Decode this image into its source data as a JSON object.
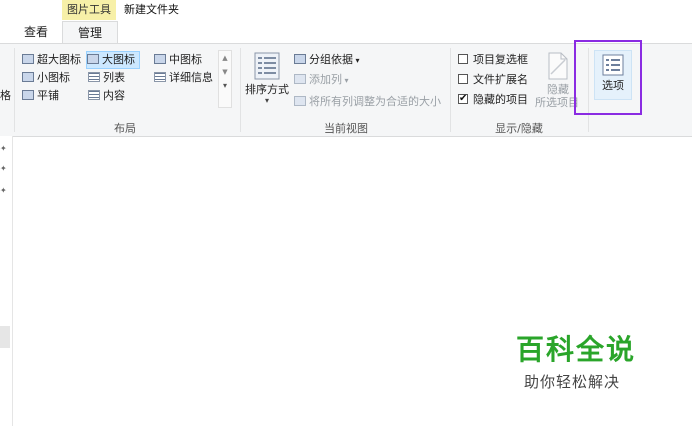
{
  "context_tab": "图片工具",
  "window_title": "新建文件夹",
  "tabs": [
    {
      "label": "查看"
    },
    {
      "label": "管理"
    }
  ],
  "ribbon": {
    "left_cut_text": "格",
    "layout": {
      "group_label": "布局",
      "items": [
        {
          "label": "超大图标"
        },
        {
          "label": "大图标"
        },
        {
          "label": "中图标"
        },
        {
          "label": "小图标"
        },
        {
          "label": "列表"
        },
        {
          "label": "详细信息"
        },
        {
          "label": "平铺"
        },
        {
          "label": "内容"
        }
      ]
    },
    "current_view": {
      "group_label": "当前视图",
      "sort_label": "排序方式",
      "group_by_label": "分组依据",
      "add_column_label": "添加列",
      "fit_columns_label": "将所有列调整为合适的大小"
    },
    "show_hide": {
      "group_label": "显示/隐藏",
      "checkboxes": [
        {
          "label": "项目复选框",
          "checked": false
        },
        {
          "label": "文件扩展名",
          "checked": false
        },
        {
          "label": "隐藏的项目",
          "checked": true
        }
      ],
      "hide_selected_line1": "隐藏",
      "hide_selected_line2": "所选项目"
    },
    "options": {
      "label": "选项",
      "highlight_color": "#8a2be2"
    }
  },
  "watermark": {
    "main": "百科全说",
    "sub": "助你轻松解决",
    "color": "#2aa52a"
  }
}
